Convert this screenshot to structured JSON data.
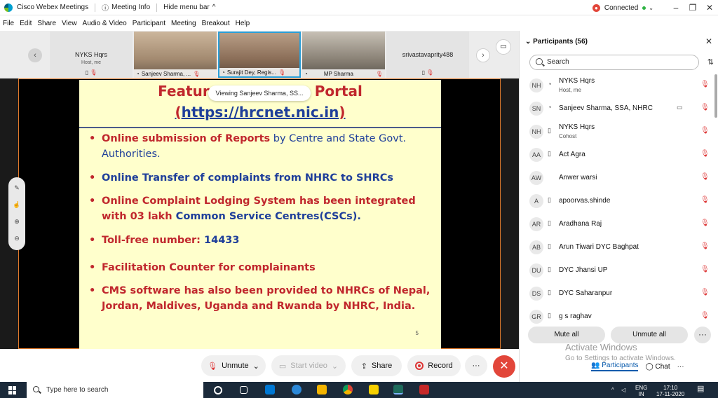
{
  "titlebar": {
    "app_title": "Cisco Webex Meetings",
    "meeting_info": "Meeting Info",
    "hide_menu": "Hide menu bar",
    "status": "Connected",
    "minimize": "–",
    "maximize": "❐",
    "close": "✕"
  },
  "menu": [
    "File",
    "Edit",
    "Share",
    "View",
    "Audio & Video",
    "Participant",
    "Meeting",
    "Breakout",
    "Help"
  ],
  "strip": {
    "tile_host_name": "NYKS Hqrs",
    "tile_host_sub": "Host, me",
    "tile_1_caption": "Sanjeev Sharma, ...",
    "tile_2_caption": "Surajit Dey, Regis...",
    "tile_3_caption": "MP Sharma",
    "tile_4_name": "srivastavaprity488"
  },
  "slide": {
    "title_left": "Featur",
    "title_right": "Portal",
    "viewing": "Viewing Sanjeev Sharma, SS...",
    "url_open": "(",
    "url": "https://hrcnet.nic.in",
    "url_close": ")",
    "b1_red": "Online submission of Reports",
    "b1_blue": " by Centre and State Govt. Authorities.",
    "b2": "Online Transfer of complaints  from NHRC to SHRCs",
    "b3_red": "Online Complaint Lodging System has been integrated with 03 lakh ",
    "b3_blue": "Common Service Centres(CSCs).",
    "b4_red": "Toll-free number: ",
    "b4_blue": "14433",
    "b5": "Facilitation Counter for complainants",
    "b6": "CMS software has also been provided to NHRCs of Nepal, Jordan, Maldives, Uganda and Rwanda by NHRC, India.",
    "page_number": "5"
  },
  "controls": {
    "unmute": "Unmute",
    "start_video": "Start video",
    "share": "Share",
    "record": "Record",
    "more": "···",
    "end": "✕"
  },
  "panel": {
    "title": "Participants (56)",
    "search_placeholder": "Search",
    "participants": [
      {
        "initials": "NH",
        "name": "NYKS Hqrs",
        "sub": "Host, me"
      },
      {
        "initials": "SN",
        "name": "Sanjeev Sharma, SSA, NHRC",
        "sub": ""
      },
      {
        "initials": "NH",
        "name": "NYKS Hqrs",
        "sub": "Cohost"
      },
      {
        "initials": "AA",
        "name": "Act Agra",
        "sub": ""
      },
      {
        "initials": "AW",
        "name": "Anwer warsi",
        "sub": ""
      },
      {
        "initials": "A",
        "name": "apoorvas.shinde",
        "sub": ""
      },
      {
        "initials": "AR",
        "name": "Aradhana Raj",
        "sub": ""
      },
      {
        "initials": "AB",
        "name": "Arun Tiwari DYC Baghpat",
        "sub": ""
      },
      {
        "initials": "DU",
        "name": "DYC Jhansi UP",
        "sub": ""
      },
      {
        "initials": "DS",
        "name": "DYC Saharanpur",
        "sub": ""
      },
      {
        "initials": "GR",
        "name": "g s raghav",
        "sub": ""
      }
    ],
    "mute_all": "Mute all",
    "unmute_all": "Unmute all",
    "watermark_title": "Activate Windows",
    "watermark_sub": "Go to Settings to activate Windows.",
    "tab_participants": "Participants",
    "tab_chat": "Chat"
  },
  "taskbar": {
    "search_placeholder": "Type here to search",
    "lang": "ENG",
    "region": "IN",
    "time": "17:10",
    "date": "17-11-2020"
  }
}
